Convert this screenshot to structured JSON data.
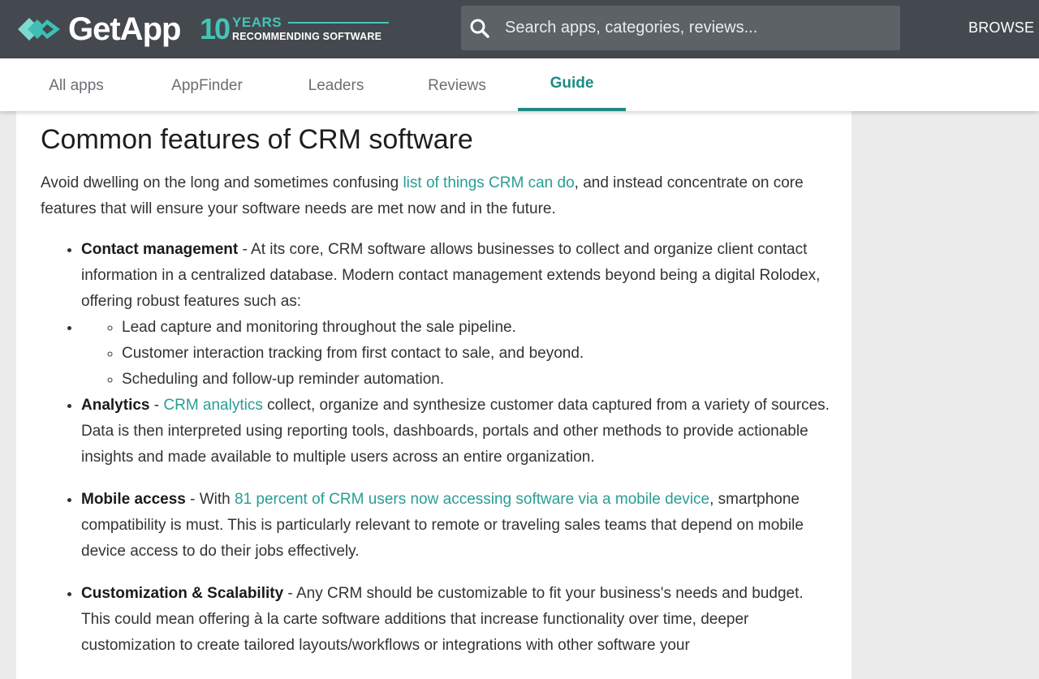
{
  "header": {
    "brand": "GetApp",
    "badge_number": "10",
    "badge_years": "YEARS",
    "badge_tagline": "RECOMMENDING SOFTWARE",
    "search_placeholder": "Search apps, categories, reviews...",
    "browse_label": "BROWSE"
  },
  "tabs": [
    {
      "label": "All apps",
      "active": false
    },
    {
      "label": "AppFinder",
      "active": false
    },
    {
      "label": "Leaders",
      "active": false
    },
    {
      "label": "Reviews",
      "active": false
    },
    {
      "label": "Guide",
      "active": true
    }
  ],
  "article": {
    "title": "Common features of CRM software",
    "intro_before": "Avoid dwelling on the long and sometimes confusing ",
    "intro_link": "list of things CRM can do",
    "intro_after": ", and instead concentrate on core features that will ensure your software needs are met now and in the future.",
    "features": [
      {
        "title": "Contact management",
        "text": " - At its core, CRM software allows businesses to collect and organize client contact information in a centralized database. Modern contact management extends beyond being a digital Rolodex, offering robust features such as:"
      },
      {
        "subitems": [
          "Lead capture and monitoring throughout the sale pipeline.",
          "Customer interaction tracking from first contact to sale, and beyond.",
          "Scheduling and follow-up reminder automation."
        ]
      },
      {
        "title": "Analytics",
        "sep": " - ",
        "link": "CRM analytics",
        "text": " collect, organize and synthesize customer data captured from a variety of sources. Data is then interpreted using reporting tools, dashboards, portals and other methods to provide actionable insights and made available to multiple users across an entire organization."
      },
      {
        "title": "Mobile access",
        "sep": " - With ",
        "link": "81 percent of CRM users now accessing software via a mobile device",
        "text": ", smartphone compatibility is must. This is particularly relevant to remote or traveling sales teams that depend on mobile device access to do their jobs effectively."
      },
      {
        "title": "Customization & Scalability",
        "text": " - Any CRM should be customizable to fit your business's needs and budget. This could mean offering à la carte software additions that increase functionality over time, deeper customization to create tailored layouts/workflows or integrations with other software your"
      }
    ]
  },
  "colors": {
    "topbar": "#44494f",
    "accent": "#1f8a83",
    "link": "#2a9d94",
    "badge": "#45c4b8"
  }
}
